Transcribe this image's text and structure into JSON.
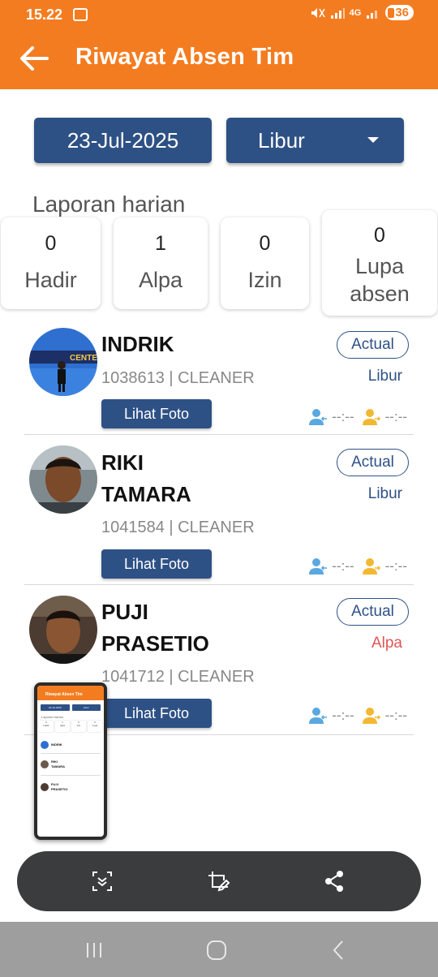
{
  "status_bar": {
    "time": "15.22",
    "network": "4G",
    "battery": "36"
  },
  "header": {
    "title": "Riwayat Absen Tim"
  },
  "filters": {
    "date": "23-Jul-2025",
    "status": "Libur"
  },
  "summary": {
    "section_label": "Laporan harian",
    "hadir": {
      "count": "0",
      "label": "Hadir"
    },
    "alpa": {
      "count": "1",
      "label": "Alpa"
    },
    "izin": {
      "count": "0",
      "label": "Izin"
    },
    "lupa": {
      "count": "0",
      "label": "Lupa absen"
    }
  },
  "employees": [
    {
      "name_line1": "INDRIK",
      "name_line2": "",
      "meta": "1038613 | CLEANER",
      "badge": "Actual",
      "status": "Libur",
      "status_color": "#2e5185",
      "button": "Lihat Foto",
      "time_in": "--:--",
      "time_out": "--:--"
    },
    {
      "name_line1": "RIKI",
      "name_line2": "TAMARA",
      "meta": "1041584 | CLEANER",
      "badge": "Actual",
      "status": "Libur",
      "status_color": "#2e5185",
      "button": "Lihat Foto",
      "time_in": "--:--",
      "time_out": "--:--"
    },
    {
      "name_line1": "PUJI",
      "name_line2": "PRASETIO",
      "meta": "1041712 | CLEANER",
      "badge": "Actual",
      "status": "Alpa",
      "status_color": "#e05555",
      "button": "Lihat Foto",
      "time_in": "--:--",
      "time_out": "--:--"
    }
  ],
  "avatar_texts": {
    "banner": "CENTER"
  },
  "thumbnail": {
    "title": "Riwayat Absen Tim",
    "date": "23-Jul-2025",
    "status": "Libur",
    "section": "Laporan harian",
    "counts": [
      "0",
      "1",
      "0",
      "0"
    ],
    "labels": [
      "Hadir",
      "Alpa",
      "Izin",
      "Lupa"
    ],
    "names": [
      "INDRIK",
      "RIKI",
      "TAMARA",
      "PUJI",
      "PRASETIO"
    ]
  },
  "colors": {
    "primary": "#f47c20",
    "accent_blue": "#2e5185",
    "status_red": "#e05555",
    "clock_in_icon": "#5aa8e0",
    "clock_out_icon": "#f2b832"
  },
  "icons": {
    "back": "arrow-left-icon",
    "dropdown": "caret-down-icon",
    "clock_in": "user-arrow-in-icon",
    "clock_out": "user-arrow-out-icon",
    "toolbar": [
      "scroll-capture-icon",
      "edit-crop-icon",
      "share-icon"
    ],
    "nav": [
      "recents-icon",
      "home-icon",
      "back-nav-icon"
    ]
  }
}
